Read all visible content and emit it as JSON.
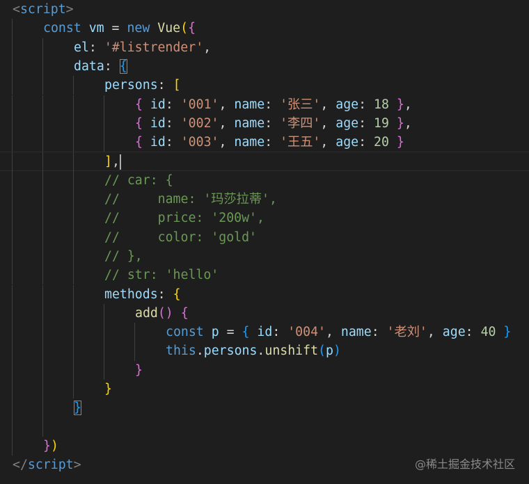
{
  "editor": {
    "lines": [
      {
        "indent": 0,
        "tokens": [
          [
            "<",
            "tp"
          ],
          [
            "script",
            "tag"
          ],
          [
            ">",
            "tp"
          ]
        ]
      },
      {
        "indent": 1,
        "tokens": [
          [
            "const",
            "kw"
          ],
          [
            " ",
            "pl"
          ],
          [
            "vm",
            "var"
          ],
          [
            " = ",
            "pl"
          ],
          [
            "new",
            "kw"
          ],
          [
            " ",
            "pl"
          ],
          [
            "Vue",
            "fn"
          ],
          [
            "(",
            "b1"
          ],
          [
            "{",
            "b2"
          ]
        ]
      },
      {
        "indent": 2,
        "tokens": [
          [
            "el",
            "var"
          ],
          [
            ": ",
            "pl"
          ],
          [
            "'#listrender'",
            "str"
          ],
          [
            ",",
            "pl"
          ]
        ]
      },
      {
        "indent": 2,
        "tokens": [
          [
            "data",
            "var"
          ],
          [
            ": ",
            "pl"
          ],
          [
            "{",
            "b3 bm"
          ]
        ]
      },
      {
        "indent": 3,
        "tokens": [
          [
            "persons",
            "var"
          ],
          [
            ": ",
            "pl"
          ],
          [
            "[",
            "b1"
          ]
        ]
      },
      {
        "indent": 4,
        "tokens": [
          [
            "{",
            "b2"
          ],
          [
            " ",
            "pl"
          ],
          [
            "id",
            "var"
          ],
          [
            ": ",
            "pl"
          ],
          [
            "'001'",
            "str"
          ],
          [
            ", ",
            "pl"
          ],
          [
            "name",
            "var"
          ],
          [
            ": ",
            "pl"
          ],
          [
            "'张三'",
            "str"
          ],
          [
            ", ",
            "pl"
          ],
          [
            "age",
            "var"
          ],
          [
            ": ",
            "pl"
          ],
          [
            "18",
            "num"
          ],
          [
            " ",
            "pl"
          ],
          [
            "}",
            "b2"
          ],
          [
            ",",
            "pl"
          ]
        ]
      },
      {
        "indent": 4,
        "tokens": [
          [
            "{",
            "b2"
          ],
          [
            " ",
            "pl"
          ],
          [
            "id",
            "var"
          ],
          [
            ": ",
            "pl"
          ],
          [
            "'002'",
            "str"
          ],
          [
            ", ",
            "pl"
          ],
          [
            "name",
            "var"
          ],
          [
            ": ",
            "pl"
          ],
          [
            "'李四'",
            "str"
          ],
          [
            ", ",
            "pl"
          ],
          [
            "age",
            "var"
          ],
          [
            ": ",
            "pl"
          ],
          [
            "19",
            "num"
          ],
          [
            " ",
            "pl"
          ],
          [
            "}",
            "b2"
          ],
          [
            ",",
            "pl"
          ]
        ]
      },
      {
        "indent": 4,
        "tokens": [
          [
            "{",
            "b2"
          ],
          [
            " ",
            "pl"
          ],
          [
            "id",
            "var"
          ],
          [
            ": ",
            "pl"
          ],
          [
            "'003'",
            "str"
          ],
          [
            ", ",
            "pl"
          ],
          [
            "name",
            "var"
          ],
          [
            ": ",
            "pl"
          ],
          [
            "'王五'",
            "str"
          ],
          [
            ", ",
            "pl"
          ],
          [
            "age",
            "var"
          ],
          [
            ": ",
            "pl"
          ],
          [
            "20",
            "num"
          ],
          [
            " ",
            "pl"
          ],
          [
            "}",
            "b2"
          ]
        ]
      },
      {
        "indent": 3,
        "current": true,
        "tokens": [
          [
            "]",
            "b1"
          ],
          [
            ",",
            "pl"
          ]
        ]
      },
      {
        "indent": 3,
        "tokens": [
          [
            "// car: {",
            "cm"
          ]
        ]
      },
      {
        "indent": 3,
        "tokens": [
          [
            "//     name: '玛莎拉蒂',",
            "cm"
          ]
        ]
      },
      {
        "indent": 3,
        "tokens": [
          [
            "//     price: '200w',",
            "cm"
          ]
        ]
      },
      {
        "indent": 3,
        "tokens": [
          [
            "//     color: 'gold'",
            "cm"
          ]
        ]
      },
      {
        "indent": 3,
        "tokens": [
          [
            "// },",
            "cm"
          ]
        ]
      },
      {
        "indent": 3,
        "tokens": [
          [
            "// str: 'hello'",
            "cm"
          ]
        ]
      },
      {
        "indent": 3,
        "tokens": [
          [
            "methods",
            "var"
          ],
          [
            ": ",
            "pl"
          ],
          [
            "{",
            "b1"
          ]
        ]
      },
      {
        "indent": 4,
        "tokens": [
          [
            "add",
            "fn"
          ],
          [
            "()",
            "b2"
          ],
          [
            " ",
            "pl"
          ],
          [
            "{",
            "b2"
          ]
        ]
      },
      {
        "indent": 5,
        "tokens": [
          [
            "const",
            "kw"
          ],
          [
            " ",
            "pl"
          ],
          [
            "p",
            "var"
          ],
          [
            " = ",
            "pl"
          ],
          [
            "{",
            "b3"
          ],
          [
            " ",
            "pl"
          ],
          [
            "id",
            "var"
          ],
          [
            ": ",
            "pl"
          ],
          [
            "'004'",
            "str"
          ],
          [
            ", ",
            "pl"
          ],
          [
            "name",
            "var"
          ],
          [
            ": ",
            "pl"
          ],
          [
            "'老刘'",
            "str"
          ],
          [
            ", ",
            "pl"
          ],
          [
            "age",
            "var"
          ],
          [
            ": ",
            "pl"
          ],
          [
            "40",
            "num"
          ],
          [
            " ",
            "pl"
          ],
          [
            "}",
            "b3"
          ]
        ]
      },
      {
        "indent": 5,
        "tokens": [
          [
            "this",
            "kw"
          ],
          [
            ".",
            "pl"
          ],
          [
            "persons",
            "var"
          ],
          [
            ".",
            "pl"
          ],
          [
            "unshift",
            "fn"
          ],
          [
            "(",
            "b3"
          ],
          [
            "p",
            "var"
          ],
          [
            ")",
            "b3"
          ]
        ]
      },
      {
        "indent": 4,
        "tokens": [
          [
            "}",
            "b2"
          ]
        ]
      },
      {
        "indent": 3,
        "tokens": [
          [
            "}",
            "b1"
          ]
        ]
      },
      {
        "indent": 2,
        "tokens": [
          [
            "}",
            "b3 bm"
          ]
        ]
      },
      {
        "indent": 2,
        "tokens": []
      },
      {
        "indent": 1,
        "tokens": [
          [
            "}",
            "b2"
          ],
          [
            ")",
            "b1"
          ]
        ]
      },
      {
        "indent": 0,
        "tokens": [
          [
            "</",
            "tp"
          ],
          [
            "script",
            "tag"
          ],
          [
            ">",
            "tp"
          ]
        ]
      }
    ]
  },
  "watermark": "@稀土掘金技术社区",
  "colors": {
    "background": "#1e1e1e",
    "keyword": "#569cd6",
    "string": "#ce9178",
    "comment": "#6a9955",
    "number": "#b5cea8",
    "function": "#dcdcaa",
    "variable": "#9cdcfe"
  }
}
